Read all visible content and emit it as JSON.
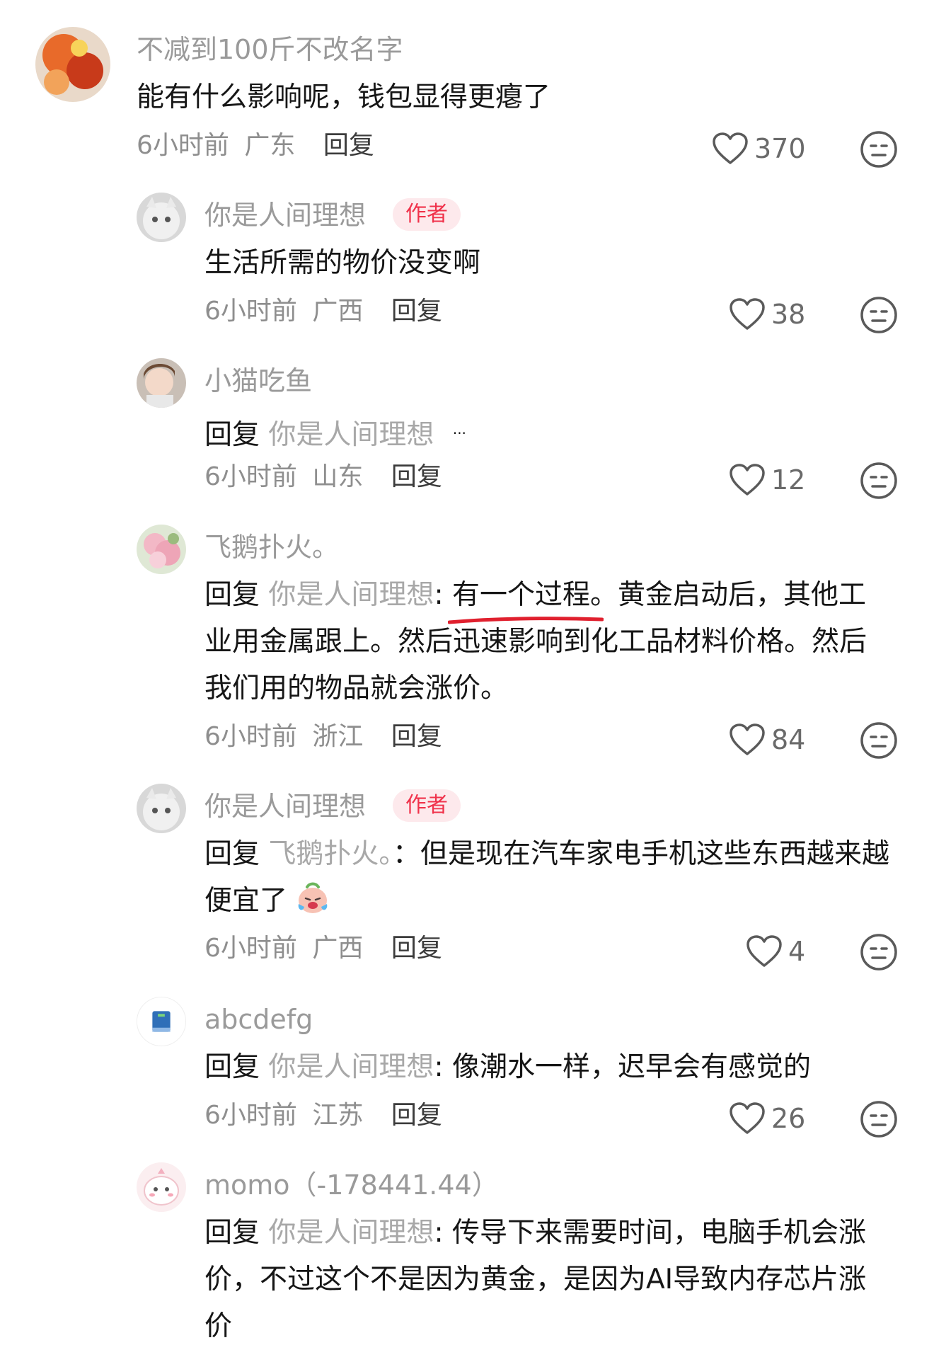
{
  "comments": [
    {
      "user": "不减到100斤不改名字",
      "text": "能有什么影响呢，钱包显得更瘪了",
      "time": "6小时前",
      "location": "广东",
      "reply_label": "回复",
      "likes": "370"
    },
    {
      "user": "你是人间理想",
      "badge": "作者",
      "text": "生活所需的物价没变啊",
      "time": "6小时前",
      "location": "广西",
      "reply_label": "回复",
      "likes": "38"
    },
    {
      "user": "小猫吃鱼",
      "reply_word": "回复",
      "reply_to": "你是人间理想",
      "text_fragment": "...",
      "time": "6小时前",
      "location": "山东",
      "reply_label": "回复",
      "likes": "12"
    },
    {
      "user": "飞鹅扑火。",
      "reply_word": "回复",
      "reply_to": "你是人间理想",
      "colon": ": ",
      "underlined_text": "有一个过程",
      "text": "。黄金启动后，其他工业用金属跟上。然后迅速影响到化工品材料价格。然后我们用的物品就会涨价。",
      "time": "6小时前",
      "location": "浙江",
      "reply_label": "回复",
      "likes": "84"
    },
    {
      "user": "你是人间理想",
      "badge": "作者",
      "reply_word": "回复",
      "reply_to": "飞鹅扑火。",
      "colon": "：",
      "text": "但是现在汽车家电手机这些东西越来越便宜了",
      "emoji": "crying-laughing-emoji",
      "time": "6小时前",
      "location": "广西",
      "reply_label": "回复",
      "likes": "4"
    },
    {
      "user": "abcdefg",
      "reply_word": "回复",
      "reply_to": "你是人间理想",
      "colon": ": ",
      "text": "像潮水一样，迟早会有感觉的",
      "time": "6小时前",
      "location": "江苏",
      "reply_label": "回复",
      "likes": "26"
    },
    {
      "user": "momo（-178441.44）",
      "reply_word": "回复",
      "reply_to": "你是人间理想",
      "colon": ": ",
      "text": "传导下来需要时间，电脑手机会涨价，不过这个不是因为黄金，是因为AI导致内存芯片涨价"
    }
  ],
  "colors": {
    "badge_bg": "#fde9ec",
    "badge_text": "#f0324b",
    "underline": "#e0202e"
  }
}
